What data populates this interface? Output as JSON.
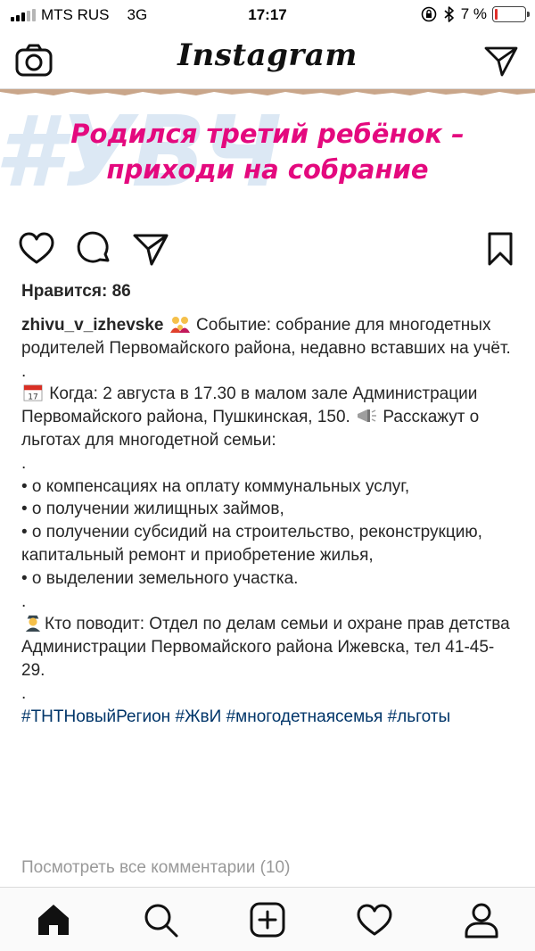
{
  "status_bar": {
    "carrier": "MTS RUS",
    "network": "3G",
    "time": "17:17",
    "battery_percent": "7 %",
    "battery_level": 0.07,
    "battery_color": "#e0302b"
  },
  "nav": {
    "logo": "Instagram",
    "left_icon": "camera-icon",
    "right_icon": "direct-message-icon"
  },
  "post_image": {
    "background_tag": "#УВЧ",
    "headline_line1": "Родился третий ребёнок –",
    "headline_line2": "приходи на собрание",
    "headline_color": "#e4097e"
  },
  "actions": {
    "icons": [
      "heart-icon",
      "comment-icon",
      "share-icon",
      "bookmark-icon"
    ]
  },
  "likes_text": "Нравится: 86",
  "caption": {
    "username": "zhivu_v_izhevske",
    "p1": " Событие: собрание для многодетных родителей Первомайского района, недавно вставших на учёт.",
    "dot1": ".",
    "p2": " Когда: 2 августа в 17.30 в малом зале Администрации Первомайского района, Пушкинская, 150.",
    "p2b": " Расскажут о льготах для многодетной семьи:",
    "dot2": ".",
    "bullets": [
      "• о компенсациях на оплату коммунальных услуг,",
      "• о получении жилищных займов,",
      "• о получении субсидий на строительство, реконструкцию, капитальный ремонт и приобретение жилья,",
      "• о выделении земельного участка."
    ],
    "dot3": ".",
    "p3": "Кто поводит: Отдел по делам семьи и охране прав детства Администрации Первомайского района Ижевска, тел 41-45-29.",
    "dot4": ".",
    "hashtags": "#ТНТНовыйРегион #ЖвИ #многодетнаясемья #льготы"
  },
  "view_comments": "Посмотреть все комментарии (10)",
  "tab_bar": {
    "icons": [
      "home-icon",
      "search-icon",
      "new-post-icon",
      "activity-icon",
      "profile-icon"
    ]
  }
}
